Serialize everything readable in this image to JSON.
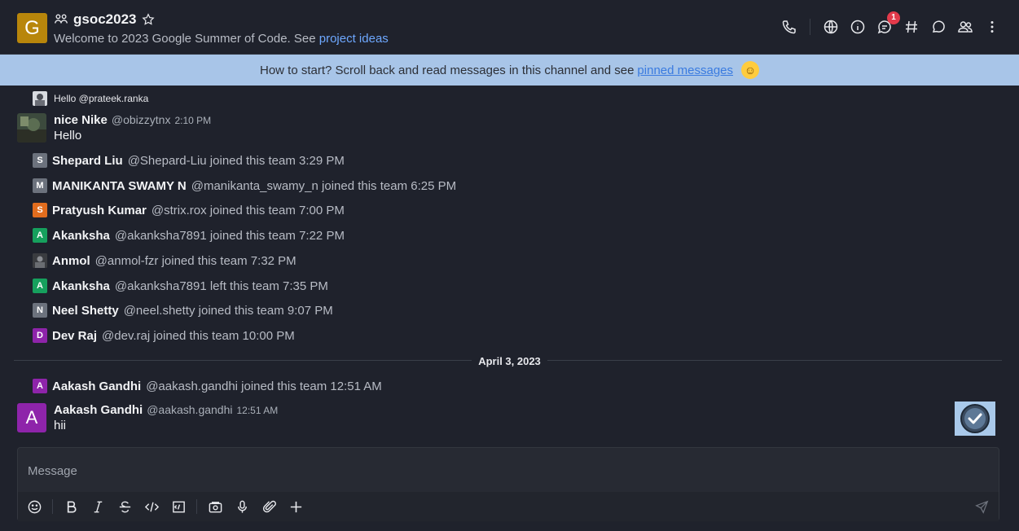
{
  "header": {
    "avatar_letter": "G",
    "room_name": "gsoc2023",
    "topic_prefix": "Welcome to 2023 Google Summer of Code. See ",
    "topic_link": "project ideas",
    "notification_count": "1"
  },
  "announcement": {
    "text": "How to start? Scroll back and read messages in this channel and see ",
    "link": "pinned messages"
  },
  "thread_preview": {
    "text": "Hello @prateek.ranka"
  },
  "messages": [
    {
      "name": "nice Nike",
      "handle": "@obizzytnx",
      "time": "2:10 PM",
      "text": "Hello"
    },
    {
      "avatar_letter": "A",
      "name": "Aakash Gandhi",
      "handle": "@aakash.gandhi",
      "time": "12:51 AM",
      "text": "hii"
    }
  ],
  "system_messages": [
    {
      "letter": "S",
      "color": "#6c727d",
      "name": "Shepard Liu",
      "text": "@Shepard-Liu joined this team 3:29 PM"
    },
    {
      "letter": "M",
      "color": "#6c727d",
      "name": "MANIKANTA SWAMY N",
      "text": "@manikanta_swamy_n joined this team 6:25 PM"
    },
    {
      "letter": "S",
      "color": "#e26d1e",
      "name": "Pratyush Kumar",
      "text": "@strix.rox joined this team 7:00 PM"
    },
    {
      "letter": "A",
      "color": "#16a05d",
      "name": "Akanksha",
      "text": "@akanksha7891 joined this team 7:22 PM"
    },
    {
      "letter": "",
      "color": "#4a4d52",
      "name": "Anmol",
      "text": "@anmol-fzr joined this team 7:32 PM"
    },
    {
      "letter": "A",
      "color": "#16a05d",
      "name": "Akanksha",
      "text": "@akanksha7891 left this team 7:35 PM"
    },
    {
      "letter": "N",
      "color": "#6c727d",
      "name": "Neel Shetty",
      "text": "@neel.shetty joined this team 9:07 PM"
    },
    {
      "letter": "D",
      "color": "#8e24aa",
      "name": "Dev Raj",
      "text": "@dev.raj joined this team 10:00 PM"
    },
    {
      "letter": "A",
      "color": "#8e24aa",
      "name": "Aakash Gandhi",
      "text": "@aakash.gandhi joined this team 12:51 AM"
    }
  ],
  "date_divider": "April 3, 2023",
  "composer": {
    "placeholder": "Message"
  },
  "colors": {
    "accent": "#6ea8ff",
    "announcement_bg": "#a8c5e8",
    "room_avatar": "#b8860b",
    "badge": "#e33a4b"
  }
}
